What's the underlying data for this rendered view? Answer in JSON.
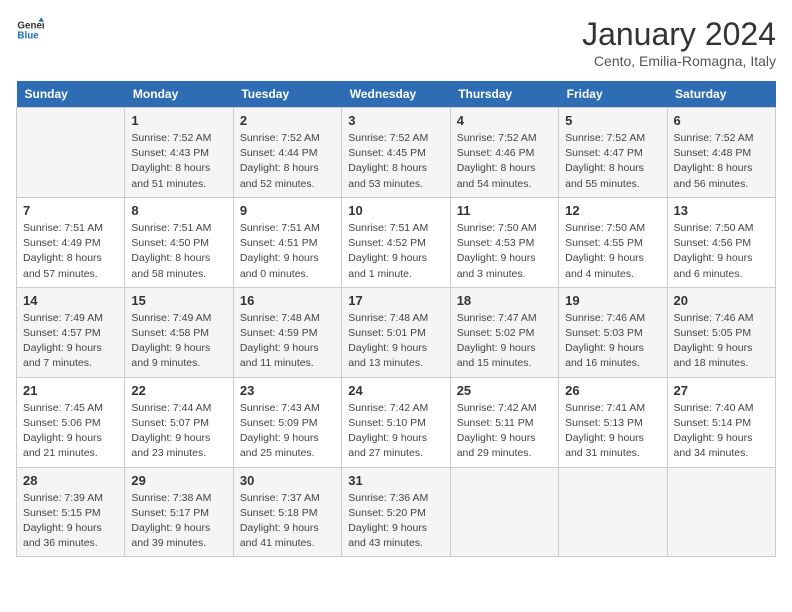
{
  "logo": {
    "line1": "General",
    "line2": "Blue"
  },
  "title": "January 2024",
  "subtitle": "Cento, Emilia-Romagna, Italy",
  "days_of_week": [
    "Sunday",
    "Monday",
    "Tuesday",
    "Wednesday",
    "Thursday",
    "Friday",
    "Saturday"
  ],
  "weeks": [
    [
      {
        "num": "",
        "sunrise": "",
        "sunset": "",
        "daylight": ""
      },
      {
        "num": "1",
        "sunrise": "Sunrise: 7:52 AM",
        "sunset": "Sunset: 4:43 PM",
        "daylight": "Daylight: 8 hours and 51 minutes."
      },
      {
        "num": "2",
        "sunrise": "Sunrise: 7:52 AM",
        "sunset": "Sunset: 4:44 PM",
        "daylight": "Daylight: 8 hours and 52 minutes."
      },
      {
        "num": "3",
        "sunrise": "Sunrise: 7:52 AM",
        "sunset": "Sunset: 4:45 PM",
        "daylight": "Daylight: 8 hours and 53 minutes."
      },
      {
        "num": "4",
        "sunrise": "Sunrise: 7:52 AM",
        "sunset": "Sunset: 4:46 PM",
        "daylight": "Daylight: 8 hours and 54 minutes."
      },
      {
        "num": "5",
        "sunrise": "Sunrise: 7:52 AM",
        "sunset": "Sunset: 4:47 PM",
        "daylight": "Daylight: 8 hours and 55 minutes."
      },
      {
        "num": "6",
        "sunrise": "Sunrise: 7:52 AM",
        "sunset": "Sunset: 4:48 PM",
        "daylight": "Daylight: 8 hours and 56 minutes."
      }
    ],
    [
      {
        "num": "7",
        "sunrise": "Sunrise: 7:51 AM",
        "sunset": "Sunset: 4:49 PM",
        "daylight": "Daylight: 8 hours and 57 minutes."
      },
      {
        "num": "8",
        "sunrise": "Sunrise: 7:51 AM",
        "sunset": "Sunset: 4:50 PM",
        "daylight": "Daylight: 8 hours and 58 minutes."
      },
      {
        "num": "9",
        "sunrise": "Sunrise: 7:51 AM",
        "sunset": "Sunset: 4:51 PM",
        "daylight": "Daylight: 9 hours and 0 minutes."
      },
      {
        "num": "10",
        "sunrise": "Sunrise: 7:51 AM",
        "sunset": "Sunset: 4:52 PM",
        "daylight": "Daylight: 9 hours and 1 minute."
      },
      {
        "num": "11",
        "sunrise": "Sunrise: 7:50 AM",
        "sunset": "Sunset: 4:53 PM",
        "daylight": "Daylight: 9 hours and 3 minutes."
      },
      {
        "num": "12",
        "sunrise": "Sunrise: 7:50 AM",
        "sunset": "Sunset: 4:55 PM",
        "daylight": "Daylight: 9 hours and 4 minutes."
      },
      {
        "num": "13",
        "sunrise": "Sunrise: 7:50 AM",
        "sunset": "Sunset: 4:56 PM",
        "daylight": "Daylight: 9 hours and 6 minutes."
      }
    ],
    [
      {
        "num": "14",
        "sunrise": "Sunrise: 7:49 AM",
        "sunset": "Sunset: 4:57 PM",
        "daylight": "Daylight: 9 hours and 7 minutes."
      },
      {
        "num": "15",
        "sunrise": "Sunrise: 7:49 AM",
        "sunset": "Sunset: 4:58 PM",
        "daylight": "Daylight: 9 hours and 9 minutes."
      },
      {
        "num": "16",
        "sunrise": "Sunrise: 7:48 AM",
        "sunset": "Sunset: 4:59 PM",
        "daylight": "Daylight: 9 hours and 11 minutes."
      },
      {
        "num": "17",
        "sunrise": "Sunrise: 7:48 AM",
        "sunset": "Sunset: 5:01 PM",
        "daylight": "Daylight: 9 hours and 13 minutes."
      },
      {
        "num": "18",
        "sunrise": "Sunrise: 7:47 AM",
        "sunset": "Sunset: 5:02 PM",
        "daylight": "Daylight: 9 hours and 15 minutes."
      },
      {
        "num": "19",
        "sunrise": "Sunrise: 7:46 AM",
        "sunset": "Sunset: 5:03 PM",
        "daylight": "Daylight: 9 hours and 16 minutes."
      },
      {
        "num": "20",
        "sunrise": "Sunrise: 7:46 AM",
        "sunset": "Sunset: 5:05 PM",
        "daylight": "Daylight: 9 hours and 18 minutes."
      }
    ],
    [
      {
        "num": "21",
        "sunrise": "Sunrise: 7:45 AM",
        "sunset": "Sunset: 5:06 PM",
        "daylight": "Daylight: 9 hours and 21 minutes."
      },
      {
        "num": "22",
        "sunrise": "Sunrise: 7:44 AM",
        "sunset": "Sunset: 5:07 PM",
        "daylight": "Daylight: 9 hours and 23 minutes."
      },
      {
        "num": "23",
        "sunrise": "Sunrise: 7:43 AM",
        "sunset": "Sunset: 5:09 PM",
        "daylight": "Daylight: 9 hours and 25 minutes."
      },
      {
        "num": "24",
        "sunrise": "Sunrise: 7:42 AM",
        "sunset": "Sunset: 5:10 PM",
        "daylight": "Daylight: 9 hours and 27 minutes."
      },
      {
        "num": "25",
        "sunrise": "Sunrise: 7:42 AM",
        "sunset": "Sunset: 5:11 PM",
        "daylight": "Daylight: 9 hours and 29 minutes."
      },
      {
        "num": "26",
        "sunrise": "Sunrise: 7:41 AM",
        "sunset": "Sunset: 5:13 PM",
        "daylight": "Daylight: 9 hours and 31 minutes."
      },
      {
        "num": "27",
        "sunrise": "Sunrise: 7:40 AM",
        "sunset": "Sunset: 5:14 PM",
        "daylight": "Daylight: 9 hours and 34 minutes."
      }
    ],
    [
      {
        "num": "28",
        "sunrise": "Sunrise: 7:39 AM",
        "sunset": "Sunset: 5:15 PM",
        "daylight": "Daylight: 9 hours and 36 minutes."
      },
      {
        "num": "29",
        "sunrise": "Sunrise: 7:38 AM",
        "sunset": "Sunset: 5:17 PM",
        "daylight": "Daylight: 9 hours and 39 minutes."
      },
      {
        "num": "30",
        "sunrise": "Sunrise: 7:37 AM",
        "sunset": "Sunset: 5:18 PM",
        "daylight": "Daylight: 9 hours and 41 minutes."
      },
      {
        "num": "31",
        "sunrise": "Sunrise: 7:36 AM",
        "sunset": "Sunset: 5:20 PM",
        "daylight": "Daylight: 9 hours and 43 minutes."
      },
      {
        "num": "",
        "sunrise": "",
        "sunset": "",
        "daylight": ""
      },
      {
        "num": "",
        "sunrise": "",
        "sunset": "",
        "daylight": ""
      },
      {
        "num": "",
        "sunrise": "",
        "sunset": "",
        "daylight": ""
      }
    ]
  ]
}
